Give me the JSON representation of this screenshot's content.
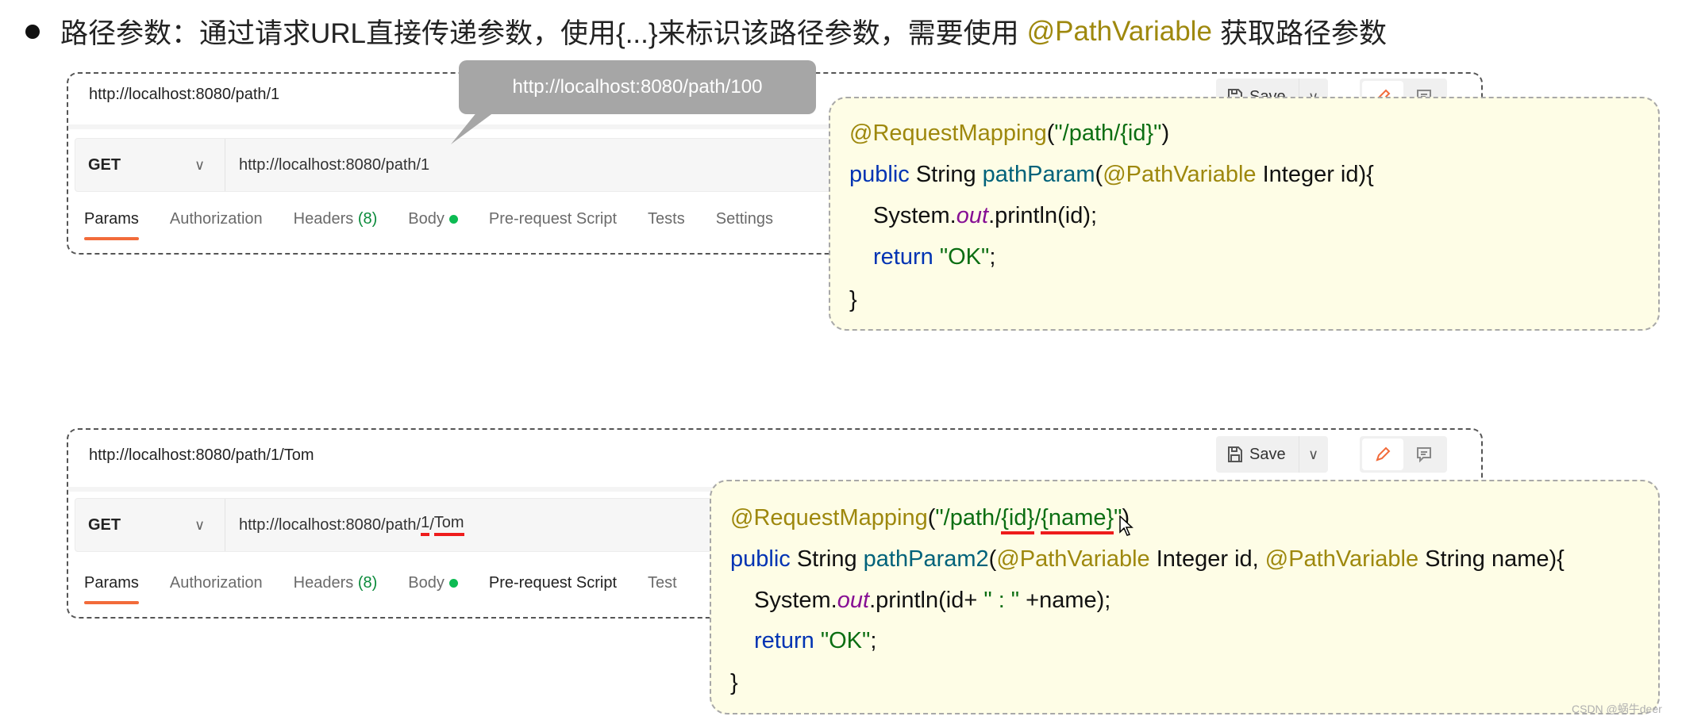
{
  "heading": {
    "text_before": "路径参数：通过请求URL直接传递参数，使用{...}来标识该路径参数，需要使用",
    "highlight": "@PathVariable",
    "text_after": "获取路径参数",
    "highlight_color": "#9e880d"
  },
  "example1": {
    "request_name": "http://localhost:8080/path/1",
    "method": "GET",
    "url": "http://localhost:8080/path/1",
    "save_label": "Save",
    "tabs": [
      "Params",
      "Authorization",
      "Headers",
      "(8)",
      "Body",
      "Pre-request Script",
      "Tests",
      "Settings"
    ],
    "tooltip": "http://localhost:8080/path/100",
    "code": [
      [
        {
          "k": "ann",
          "t": "@RequestMapping"
        },
        {
          "k": "plain",
          "t": "("
        },
        {
          "k": "str",
          "t": "\"/path/{id}\""
        },
        {
          "k": "plain",
          "t": ")"
        }
      ],
      [
        {
          "k": "kw",
          "t": "public "
        },
        {
          "k": "plain",
          "t": "String "
        },
        {
          "k": "fn",
          "t": "pathParam"
        },
        {
          "k": "plain",
          "t": "("
        },
        {
          "k": "ann",
          "t": "@PathVariable"
        },
        {
          "k": "plain",
          "t": " Integer id){"
        }
      ],
      [
        {
          "k": "plain",
          "t": "System."
        },
        {
          "k": "out",
          "t": "out"
        },
        {
          "k": "plain",
          "t": ".println(id);"
        }
      ],
      [
        {
          "k": "kw",
          "t": "return "
        },
        {
          "k": "str",
          "t": "\"OK\""
        },
        {
          "k": "plain",
          "t": ";"
        }
      ],
      [
        {
          "k": "plain",
          "t": "}"
        }
      ]
    ]
  },
  "example2": {
    "request_name": "http://localhost:8080/path/1/Tom",
    "method": "GET",
    "url_parts": [
      "http://localhost:8080/path/",
      "1",
      "/",
      "Tom"
    ],
    "save_label": "Save",
    "tabs": [
      "Params",
      "Authorization",
      "Headers",
      "(8)",
      "Body",
      "Pre-request Script",
      "Test"
    ],
    "code": [
      [
        {
          "k": "ann",
          "t": "@RequestMapping"
        },
        {
          "k": "plain",
          "t": "("
        },
        {
          "k": "str",
          "t": "\"/path/"
        },
        {
          "k": "str",
          "t": "{id}",
          "u": true
        },
        {
          "k": "str",
          "t": "/"
        },
        {
          "k": "str",
          "t": "{name}",
          "u": true
        },
        {
          "k": "str",
          "t": "\""
        },
        {
          "k": "plain",
          "t": ")"
        }
      ],
      [
        {
          "k": "kw",
          "t": "public "
        },
        {
          "k": "plain",
          "t": "String "
        },
        {
          "k": "fn",
          "t": "pathParam2"
        },
        {
          "k": "plain",
          "t": "("
        },
        {
          "k": "ann",
          "t": "@PathVariable"
        },
        {
          "k": "plain",
          "t": " Integer id, "
        },
        {
          "k": "ann",
          "t": "@PathVariable"
        },
        {
          "k": "plain",
          "t": " String name){"
        }
      ],
      [
        {
          "k": "plain",
          "t": "System."
        },
        {
          "k": "out",
          "t": "out"
        },
        {
          "k": "plain",
          "t": ".println(id+ "
        },
        {
          "k": "str",
          "t": "\" : \""
        },
        {
          "k": "plain",
          "t": " +name);"
        }
      ],
      [
        {
          "k": "kw",
          "t": "return "
        },
        {
          "k": "str",
          "t": "\"OK\""
        },
        {
          "k": "plain",
          "t": ";"
        }
      ],
      [
        {
          "k": "plain",
          "t": "}"
        }
      ]
    ]
  },
  "colors": {
    "annotation": "#9e880d",
    "string": "#0b6e12",
    "keyword": "#0033b3",
    "method": "#00627a",
    "static_field": "#871094",
    "active_tab_underline": "#f26b3a",
    "body_dot": "#0cbb52",
    "highlight_underline": "#ee1c1c",
    "code_bg": "#fefde6"
  },
  "watermark": "CSDN @蜗牛deer"
}
